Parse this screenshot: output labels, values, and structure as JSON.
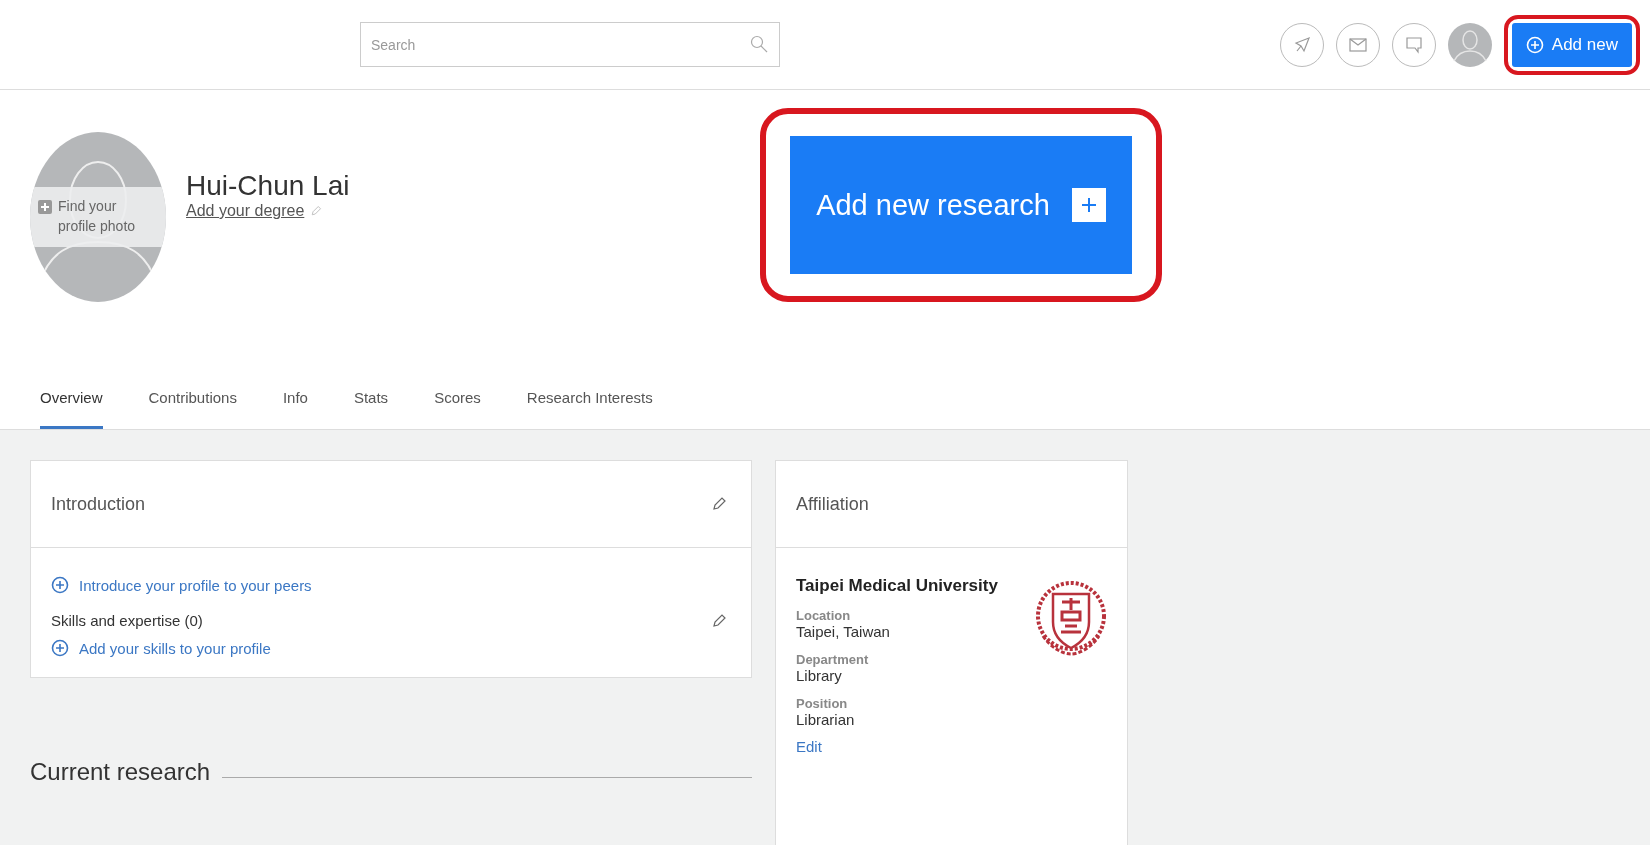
{
  "header": {
    "search": {
      "placeholder": "Search"
    },
    "add_button": {
      "label": "Add new",
      "highlighted": true
    }
  },
  "profile": {
    "photo_hint": "Find your profile photo",
    "name": "Hui-Chun Lai",
    "degree_link": "Add your degree"
  },
  "add_research": {
    "label": "Add new research",
    "highlighted": true
  },
  "tabs": [
    {
      "label": "Overview",
      "selected": true
    },
    {
      "label": "Contributions",
      "selected": false
    },
    {
      "label": "Info",
      "selected": false
    },
    {
      "label": "Stats",
      "selected": false
    },
    {
      "label": "Scores",
      "selected": false
    },
    {
      "label": "Research Interests",
      "selected": false
    }
  ],
  "introduction": {
    "title": "Introduction",
    "intro_link": "Introduce your profile to your peers",
    "skills_title": "Skills and expertise (0)",
    "skills_link": "Add your skills to your profile"
  },
  "current_research": {
    "title": "Current research"
  },
  "affiliation": {
    "title": "Affiliation",
    "institution": "Taipei Medical University",
    "fields": [
      {
        "label": "Location",
        "value": "Taipei, Taiwan"
      },
      {
        "label": "Department",
        "value": "Library"
      },
      {
        "label": "Position",
        "value": "Librarian"
      }
    ],
    "edit_link": "Edit"
  }
}
